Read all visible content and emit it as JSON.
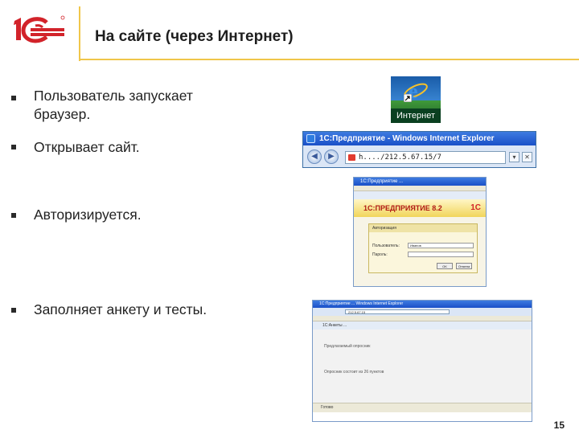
{
  "header": {
    "logo_alt": "1C",
    "title": "На сайте (через Интернет)"
  },
  "bullets": [
    {
      "text_line1": "Пользователь запускает",
      "text_line2": "браузер."
    },
    {
      "text": "Открывает сайт."
    },
    {
      "text": "Авторизируется."
    },
    {
      "text": "Заполняет анкету и тесты."
    }
  ],
  "desktop_icon": {
    "icon": "internet-explorer-icon",
    "label": "Интернет"
  },
  "browser_window": {
    "title": "1С:Предприятие - Windows Internet Explorer",
    "address": "h..../212.5.67.15/7",
    "back_icon": "back-arrow-icon",
    "forward_icon": "forward-arrow-icon"
  },
  "login_window": {
    "title": "1С:Предприятие ...",
    "brand": "1С:ПРЕДПРИЯТИЕ 8.2",
    "brand_logo": "1С",
    "dialog_title": "Авторизация",
    "user_label": "Пользователь:",
    "user_value": "Иванов",
    "password_label": "Пароль:",
    "ok_label": "OK",
    "cancel_label": "Отмена"
  },
  "questionnaire_window": {
    "title": "1С:Предприятие ... Windows Internet Explorer",
    "address": "212.5.67.15",
    "tab_label": "1С:Анкеты ...",
    "paragraph1": "Предлагаемый опросник",
    "paragraph2": "Опросник состоит из 26 пунктов",
    "status": "Готово"
  },
  "page_number": "15",
  "colors": {
    "accent_gold": "#f0c64a",
    "logo_red": "#d2232a",
    "xp_blue": "#1a50c8"
  }
}
